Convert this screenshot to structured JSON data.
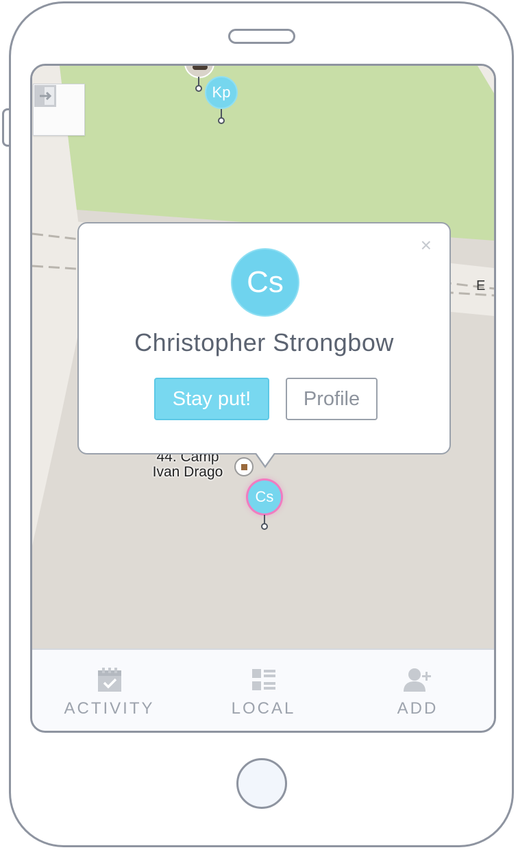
{
  "popup": {
    "avatar_initials": "Cs",
    "name": "Christopher Strongbow",
    "stay_button": "Stay put!",
    "profile_button": "Profile",
    "close_glyph": "×"
  },
  "map": {
    "place_label_line1": "44. Camp",
    "place_label_line2": "Ivan Drago",
    "road_label": "E",
    "pins": [
      {
        "initials": "Kp"
      },
      {
        "initials": "Cs"
      }
    ]
  },
  "tabs": [
    {
      "label": "ACTIVITY",
      "icon": "calendar-check-icon"
    },
    {
      "label": "LOCAL",
      "icon": "list-icon"
    },
    {
      "label": "ADD",
      "icon": "add-user-icon"
    }
  ],
  "colors": {
    "accent": "#76d6ee",
    "frame": "#8e94a0",
    "park": "#c8dea7",
    "selected_pin_ring": "#f07cc0"
  }
}
